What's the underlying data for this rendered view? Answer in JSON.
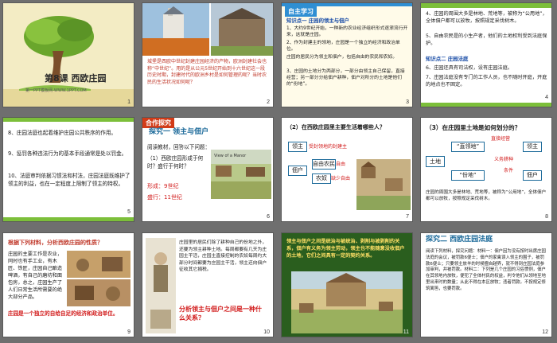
{
  "slides": [
    {
      "num": "1",
      "title": "第8课  西欧庄园",
      "footer": "第一PPT模板网-WWW.1PPT.COM"
    },
    {
      "num": "2",
      "caption": "城堡是西欧中世纪封建庄园经济的产物，欧洲封建社会也称“中世纪”。用的是从公元5世纪开始到十六世纪这一段历史时期，封建时代的欧洲乡村是如何管理的呢？当时农民的生活状况如何呢？"
    },
    {
      "num": "3",
      "header": "自主学习",
      "sub": "知识点一  庄园的领主与佃户",
      "lines": [
        "1、大约9世纪开始，一种新的农业经济组织形式逐渐流行开来，这就是庄园。",
        "2、作为封建主的领地，庄园是一个独立的经济和政治单位。",
        "庄园的居民分为领主和佃户，包括自由的农民和农奴。",
        "3、庄园的土地分为两部分，一部分由领主自己保留，直接经营；另一部分分给佃户耕种，佃户对所分的土地是他们的“份地”。"
      ],
      "red": [
        "庄园",
        "经济和政治单位",
        "自由的农民",
        "农奴",
        "直接经营",
        "份地"
      ]
    },
    {
      "num": "4",
      "lines": [
        "4、庄园的周围大多是林地、荒地等，被称为“公用地”，全体佃户都可以放牧，按照规定采伐树木。",
        "5、自由农民是的小生产者，他们的土地权利受到法庭保护。"
      ],
      "sub": "知识点二  庄园法庭",
      "lines2": [
        "6、庄园还具有司法权，设有庄园法庭。",
        "7、庄园法庭没有专门的工作人员，也不随时开庭，开庭的地点也不固定。"
      ],
      "red": [
        "公用地",
        "法庭",
        "庄园法庭",
        "不固定"
      ]
    },
    {
      "num": "5",
      "lines": [
        "8、庄园法庭也起着维护庄园公共秩序的作用。",
        "9、惩罚各种违法行为的基本手段通常是处以罚金。",
        "10、法庭审判依据习惯法和村法，庄园法庭既维护了领主的利益，也在一定程度上限制了领主的特权。"
      ],
      "red": [
        "庄园公共秩序",
        "罚金",
        "习惯法和村法",
        "领主",
        "领主"
      ]
    },
    {
      "num": "6",
      "tag": "合作探究",
      "title": "探究一  领主与佃户",
      "lines": [
        "阅读教材，回答以下问题：",
        "（1）西欧庄园形成于何时？盛行于何时？",
        "形成：9世纪",
        "盛行：11世纪"
      ],
      "photo": "View of a Manor"
    },
    {
      "num": "7",
      "question": "（2）在西欧庄园里主要生活着哪些人？",
      "labels": [
        "领主",
        "佃户",
        "自由农民",
        "农奴"
      ],
      "notes": [
        "受封领地的封建主",
        "自由",
        "缺少自由"
      ]
    },
    {
      "num": "8",
      "question": "（3）在庄园里土地是如何划分的？",
      "labels": [
        "土地",
        "“直领地”",
        "“份地”",
        "领主",
        "佃户"
      ],
      "notes": [
        "直接经营",
        "义务耕种",
        "条件"
      ],
      "caption": "庄园的周围大多是林地、荒地等，被称为“公用地”，全体佃户都可以放牧，按照规定采伐树木。"
    },
    {
      "num": "9",
      "title": "根据下列材料，分析西欧庄园的性质？",
      "text": "庄园的主要工作是农业，同时也有手工业，有木匠、铁匠，庄园自己酿造啤酒，有自己的磨坊和面包房，总之，庄园生产了人们日常生活所需要的绝大部分产品。",
      "conclusion": "庄园是一个独立的自给自足的经济和政治单位。"
    },
    {
      "num": "10",
      "text": "庄园里的居民们除了耕种自己的份地之外，还要为领主耕种土地。每周都要有几天为庄园主干活，庄园主直接控制的农奴每周约大部分时间都要为庄园主干活，领主还向佃户征收其它捐税。",
      "question": "分析领主与佃户之间是一种什么关系？"
    },
    {
      "num": "11",
      "text": "领主与佃户之间是统治与被统治、剥削与被剥削的关系，佃户有义务为领主劳动，领主也不能随意没收佃户的土地，它们之间具有一定的契约关系。"
    },
    {
      "num": "12",
      "tag": "探究二  西欧庄园法庭",
      "text": "阅读下列材料，探究问题：材料一：佃户因为没有按时出席庄园法庭的会议，被罚款6便士；佃户的家禽误入领主的围子，被罚款6便士；只要领主放羊的时候擅自越界，就不得到庄园法庭参加审判，并被罚款。材料二：下列是几个庄园的习俗惯例，佃户在其领地内放牧，便犯了全体村民的权益，判令他们从领地至地里出来时的数量；从此不得在本区放牧；违者罚款。不按规定修筑篱笆，也要罚款。"
    }
  ]
}
